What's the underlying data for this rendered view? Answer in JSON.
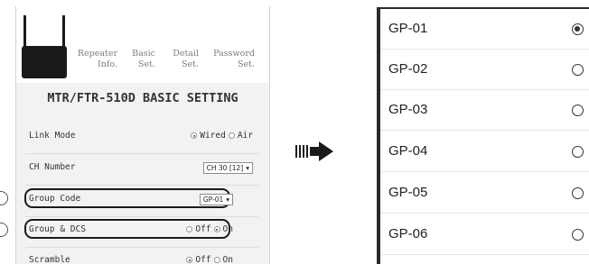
{
  "left_panel": {
    "nav": [
      {
        "line1": "Repeater",
        "line2": "Info."
      },
      {
        "line1": "Basic",
        "line2": "Set."
      },
      {
        "line1": "Detail",
        "line2": "Set."
      },
      {
        "line1": "Password",
        "line2": "Set."
      }
    ],
    "title": "MTR/FTR-510D BASIC SETTING",
    "rows": {
      "link_mode": {
        "label": "Link Mode",
        "opt1": "Wired",
        "opt2": "Air",
        "selected": "Wired"
      },
      "ch_number": {
        "label": "CH Number",
        "value": "CH 30 [12]"
      },
      "group_code": {
        "label": "Group Code",
        "value": "GP-01"
      },
      "group_dcs": {
        "label": "Group & DCS",
        "opt1": "Off",
        "opt2": "On",
        "selected": "On"
      },
      "scramble": {
        "label": "Scramble",
        "opt1": "Off",
        "opt2": "On",
        "selected": "Off"
      }
    }
  },
  "right_panel": {
    "options": [
      {
        "label": "GP-01",
        "selected": true
      },
      {
        "label": "GP-02",
        "selected": false
      },
      {
        "label": "GP-03",
        "selected": false
      },
      {
        "label": "GP-04",
        "selected": false
      },
      {
        "label": "GP-05",
        "selected": false
      },
      {
        "label": "GP-06",
        "selected": false
      }
    ]
  },
  "colors": {
    "accent": "#1a1a1a",
    "panel_bg": "#f2f2f2"
  }
}
